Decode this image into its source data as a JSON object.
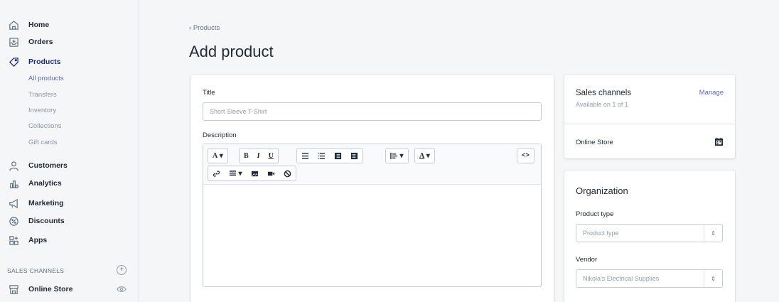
{
  "sidebar": {
    "items": [
      {
        "label": "Home",
        "icon": "home-icon"
      },
      {
        "label": "Orders",
        "icon": "orders-icon"
      },
      {
        "label": "Products",
        "icon": "tag-icon"
      }
    ],
    "sub_items": [
      "All products",
      "Transfers",
      "Inventory",
      "Collections",
      "Gift cards"
    ],
    "items2": [
      {
        "label": "Customers",
        "icon": "customers-icon"
      },
      {
        "label": "Analytics",
        "icon": "analytics-icon"
      },
      {
        "label": "Marketing",
        "icon": "marketing-icon"
      },
      {
        "label": "Discounts",
        "icon": "discounts-icon"
      },
      {
        "label": "Apps",
        "icon": "apps-icon"
      }
    ],
    "sales_channels_title": "SALES CHANNELS",
    "online_store": "Online Store"
  },
  "header": {
    "breadcrumb": "Products",
    "title": "Add product"
  },
  "main_card": {
    "title_label": "Title",
    "title_placeholder": "Short Sleeve T-Shirt",
    "description_label": "Description",
    "toolbar": {
      "font": "A",
      "bold": "B",
      "italic": "I",
      "underline": "U",
      "color": "A",
      "code": "<>"
    }
  },
  "channels_card": {
    "title": "Sales channels",
    "subtitle": "Available on 1 of 1",
    "manage": "Manage",
    "store": "Online Store"
  },
  "org_card": {
    "title": "Organization",
    "product_type_label": "Product type",
    "product_type_value": "Product type",
    "vendor_label": "Vendor",
    "vendor_value": "Nikola's Electrical Supplies"
  },
  "colors": {
    "accent": "#5c6ac4",
    "active_nav": "#202e78",
    "background": "#f4f6f8"
  }
}
